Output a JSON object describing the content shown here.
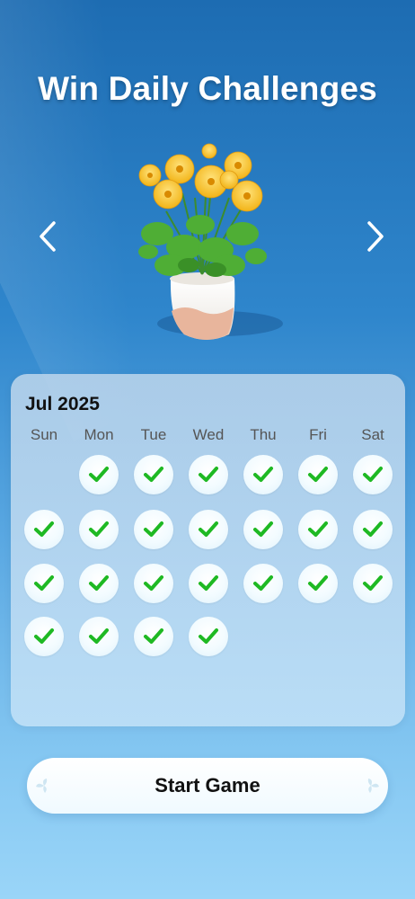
{
  "title": "Win Daily Challenges",
  "nav": {
    "prev_icon": "chevron-left-icon",
    "next_icon": "chevron-right-icon"
  },
  "plant_icon": "potted-yellow-flower-icon",
  "calendar": {
    "month_label": "Jul 2025",
    "weekdays": [
      "Sun",
      "Mon",
      "Tue",
      "Wed",
      "Thu",
      "Fri",
      "Sat"
    ],
    "first_weekday_index": 1,
    "completed_days": 24,
    "check_color": "#1fb923"
  },
  "start_button": {
    "label": "Start Game"
  }
}
